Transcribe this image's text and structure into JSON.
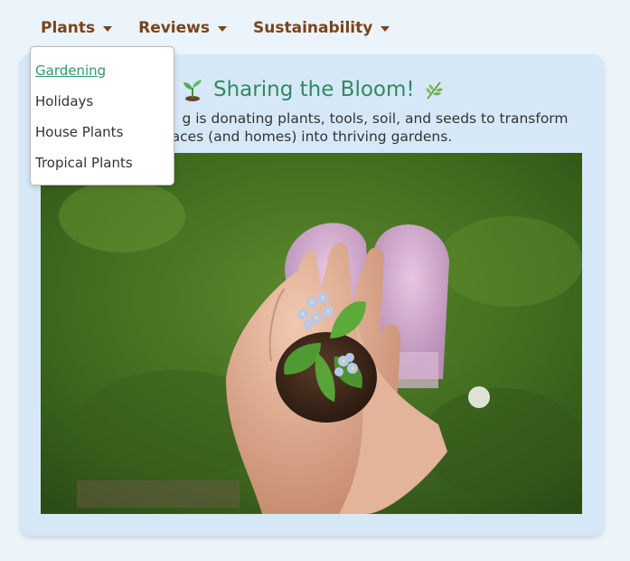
{
  "nav": {
    "items": [
      {
        "label": "Plants"
      },
      {
        "label": "Reviews"
      },
      {
        "label": "Sustainability"
      }
    ]
  },
  "dropdown": {
    "items": [
      {
        "label": "Gardening",
        "active": true
      },
      {
        "label": "Holidays"
      },
      {
        "label": "House Plants"
      },
      {
        "label": "Tropical Plants"
      }
    ]
  },
  "feature": {
    "title": "Sharing the Bloom!",
    "description_line1": "g is donating plants, tools, soil, and seeds to transform",
    "description_line2": "paces (and homes) into thriving gardens.",
    "title_icon_left": "sprout-icon",
    "title_icon_right": "herb-icon",
    "image_name": "hands-holding-seedling-photo"
  },
  "colors": {
    "background": "#ebf3fb",
    "card": "#d6e8f8",
    "nav_text": "#7a4418",
    "title_green": "#2f8a5f",
    "active_link": "#2f9a6a"
  }
}
